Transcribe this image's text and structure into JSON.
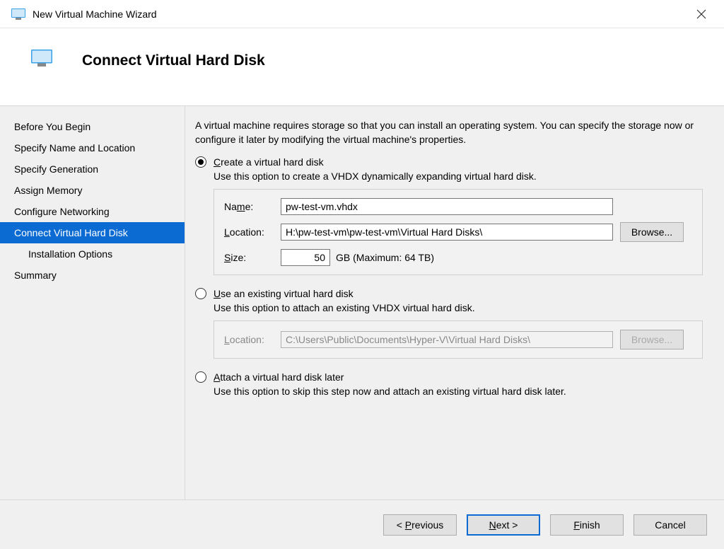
{
  "window": {
    "title": "New Virtual Machine Wizard"
  },
  "page": {
    "title": "Connect Virtual Hard Disk",
    "intro": "A virtual machine requires storage so that you can install an operating system. You can specify the storage now or configure it later by modifying the virtual machine's properties."
  },
  "sidebar": {
    "items": [
      {
        "label": "Before You Begin"
      },
      {
        "label": "Specify Name and Location"
      },
      {
        "label": "Specify Generation"
      },
      {
        "label": "Assign Memory"
      },
      {
        "label": "Configure Networking"
      },
      {
        "label": "Connect Virtual Hard Disk",
        "selected": true
      },
      {
        "label": "Installation Options",
        "indent": true
      },
      {
        "label": "Summary"
      }
    ]
  },
  "options": {
    "create": {
      "label_pre": "C",
      "label_rest": "reate a virtual hard disk",
      "description": "Use this option to create a VHDX dynamically expanding virtual hard disk.",
      "selected": true,
      "fields": {
        "name_label_pre": "Na",
        "name_label_u": "m",
        "name_label_post": "e:",
        "name_value": "pw-test-vm.vhdx",
        "location_label_u": "L",
        "location_label_post": "ocation:",
        "location_value": "H:\\pw-test-vm\\pw-test-vm\\Virtual Hard Disks\\",
        "browse_label_u": "B",
        "browse_label_post": "rowse...",
        "size_label_u": "S",
        "size_label_post": "ize:",
        "size_value": "50",
        "size_unit": "GB (Maximum: 64 TB)"
      }
    },
    "existing": {
      "label_pre": "U",
      "label_rest": "se an existing virtual hard disk",
      "description": "Use this option to attach an existing VHDX virtual hard disk.",
      "selected": false,
      "fields": {
        "location_label_u": "L",
        "location_label_post": "ocation:",
        "location_value": "C:\\Users\\Public\\Documents\\Hyper-V\\Virtual Hard Disks\\",
        "browse_label_u": "B",
        "browse_label_post": "rowse..."
      }
    },
    "later": {
      "label_pre": "A",
      "label_rest": "ttach a virtual hard disk later",
      "description": "Use this option to skip this step now and attach an existing virtual hard disk later.",
      "selected": false
    }
  },
  "footer": {
    "previous_pre": "< ",
    "previous_u": "P",
    "previous_post": "revious",
    "next_u": "N",
    "next_post": "ext >",
    "finish_u": "F",
    "finish_post": "inish",
    "cancel": "Cancel"
  }
}
